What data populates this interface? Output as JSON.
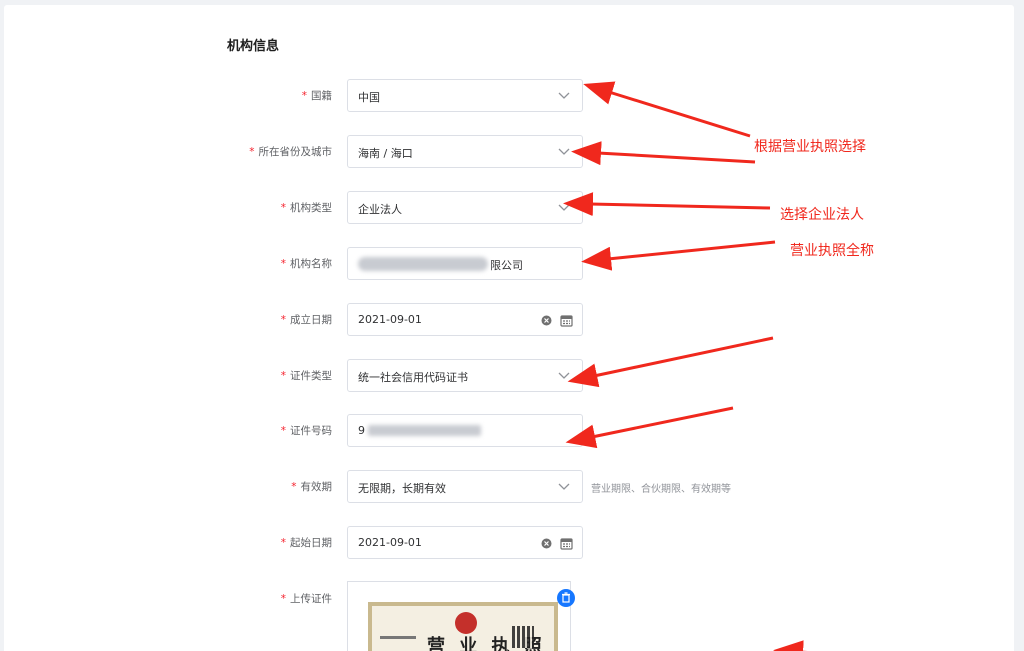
{
  "section": {
    "title": "机构信息"
  },
  "required_mark": "*",
  "fields": [
    {
      "label": "国籍",
      "value": "中国",
      "type": "select"
    },
    {
      "label": "所在省份及城市",
      "value": "海南 / 海口",
      "type": "select"
    },
    {
      "label": "机构类型",
      "value": "企业法人",
      "type": "select"
    },
    {
      "label": "机构名称",
      "value_prefix": "",
      "value_suffix": "限公司",
      "type": "input"
    },
    {
      "label": "成立日期",
      "value": "2021-09-01",
      "type": "date"
    },
    {
      "label": "证件类型",
      "value": "统一社会信用代码证书",
      "type": "select"
    },
    {
      "label": "证件号码",
      "value_prefix": "9",
      "type": "input"
    },
    {
      "label": "有效期",
      "value": "无限期，长期有效",
      "type": "select",
      "hint": "营业期限、合伙期限、有效期等"
    },
    {
      "label": "起始日期",
      "value": "2021-09-01",
      "type": "date"
    },
    {
      "label": "上传证件",
      "type": "upload"
    }
  ],
  "certificate": {
    "title": "营 业 执 照"
  },
  "annotations": {
    "choose_by_license": "根据营业执照选择",
    "choose_legal_person": "选择企业法人",
    "full_license_name": "营业执照全称"
  },
  "colors": {
    "annotation": "#f0281d",
    "required": "#f5222d",
    "accent": "#1677ff"
  },
  "icons": {
    "dropdown": "chevron-down-icon",
    "clear": "clear-icon",
    "calendar": "calendar-icon",
    "delete": "trash-icon"
  }
}
